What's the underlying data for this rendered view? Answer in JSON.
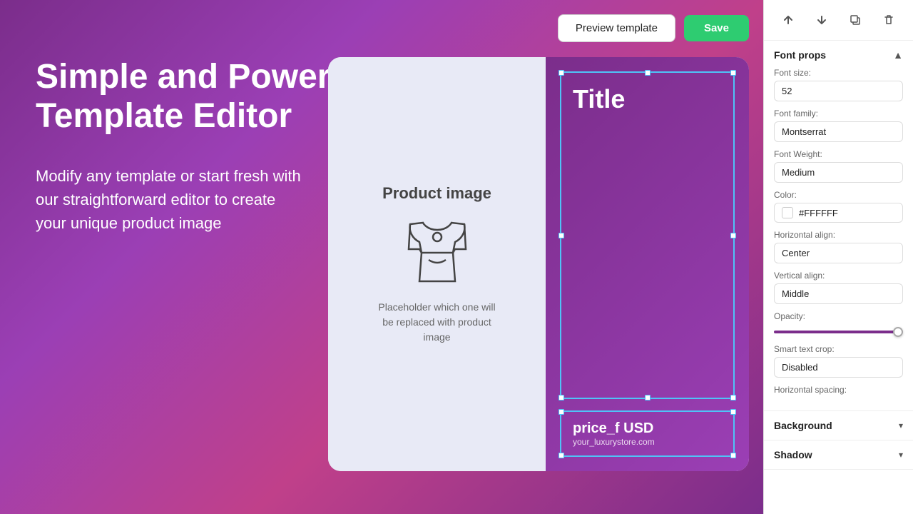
{
  "header": {
    "preview_label": "Preview template",
    "save_label": "Save"
  },
  "hero": {
    "title": "Simple and Powerful Template Editor",
    "subtitle": "Modify any template or start fresh with our straightforward editor to create your unique product image"
  },
  "template_card": {
    "product_image_label": "Product image",
    "placeholder_text": "Placeholder which one will be replaced with product image",
    "title_text": "Title",
    "price_text": "price_f USD",
    "store_text": "your_luxurystore.com"
  },
  "panel": {
    "toolbar": {
      "up_icon": "↑",
      "down_icon": "↓",
      "copy_icon": "⧉",
      "delete_icon": "🗑"
    },
    "font_props": {
      "section_title": "Font props",
      "font_size_label": "Font size:",
      "font_size_value": "52",
      "font_family_label": "Font family:",
      "font_family_value": "Montserrat",
      "font_weight_label": "Font Weight:",
      "font_weight_value": "Medium",
      "color_label": "Color:",
      "color_hex": "#FFFFFF",
      "h_align_label": "Horizontal align:",
      "h_align_value": "Center",
      "v_align_label": "Vertical align:",
      "v_align_value": "Middle",
      "opacity_label": "Opacity:",
      "smart_crop_label": "Smart text crop:",
      "smart_crop_value": "Disabled",
      "h_spacing_label": "Horizontal spacing:"
    },
    "background": {
      "label": "Background",
      "chevron": "▾"
    },
    "shadow": {
      "label": "Shadow",
      "chevron": "▾"
    }
  }
}
